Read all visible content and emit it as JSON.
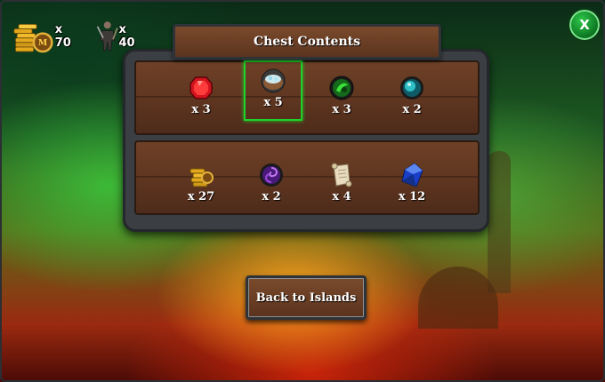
{
  "resources": [
    {
      "icon": "gold-coins-icon",
      "count": "x 70"
    },
    {
      "icon": "warrior-troops-icon",
      "count": "x 40"
    }
  ],
  "close_label": "X",
  "title": "Chest Contents",
  "rows": [
    [
      {
        "icon": "red-gem-icon",
        "qty": "x 3",
        "selected": false
      },
      {
        "icon": "bowl-of-crystals-icon",
        "qty": "x 5",
        "selected": true
      },
      {
        "icon": "green-orb-icon",
        "qty": "x 3",
        "selected": false
      },
      {
        "icon": "teal-orb-icon",
        "qty": "x 2",
        "selected": false
      }
    ],
    [
      {
        "icon": "gold-coins-icon",
        "qty": "x 27",
        "selected": false
      },
      {
        "icon": "purple-vortex-orb-icon",
        "qty": "x 2",
        "selected": false
      },
      {
        "icon": "scroll-icon",
        "qty": "x 4",
        "selected": false
      },
      {
        "icon": "blue-crystal-icon",
        "qty": "x 12",
        "selected": false
      }
    ]
  ],
  "back_button": "Back to Islands",
  "colors": {
    "selection": "#1fd12a",
    "plank": "#5e3520",
    "close": "#0f7a24"
  }
}
